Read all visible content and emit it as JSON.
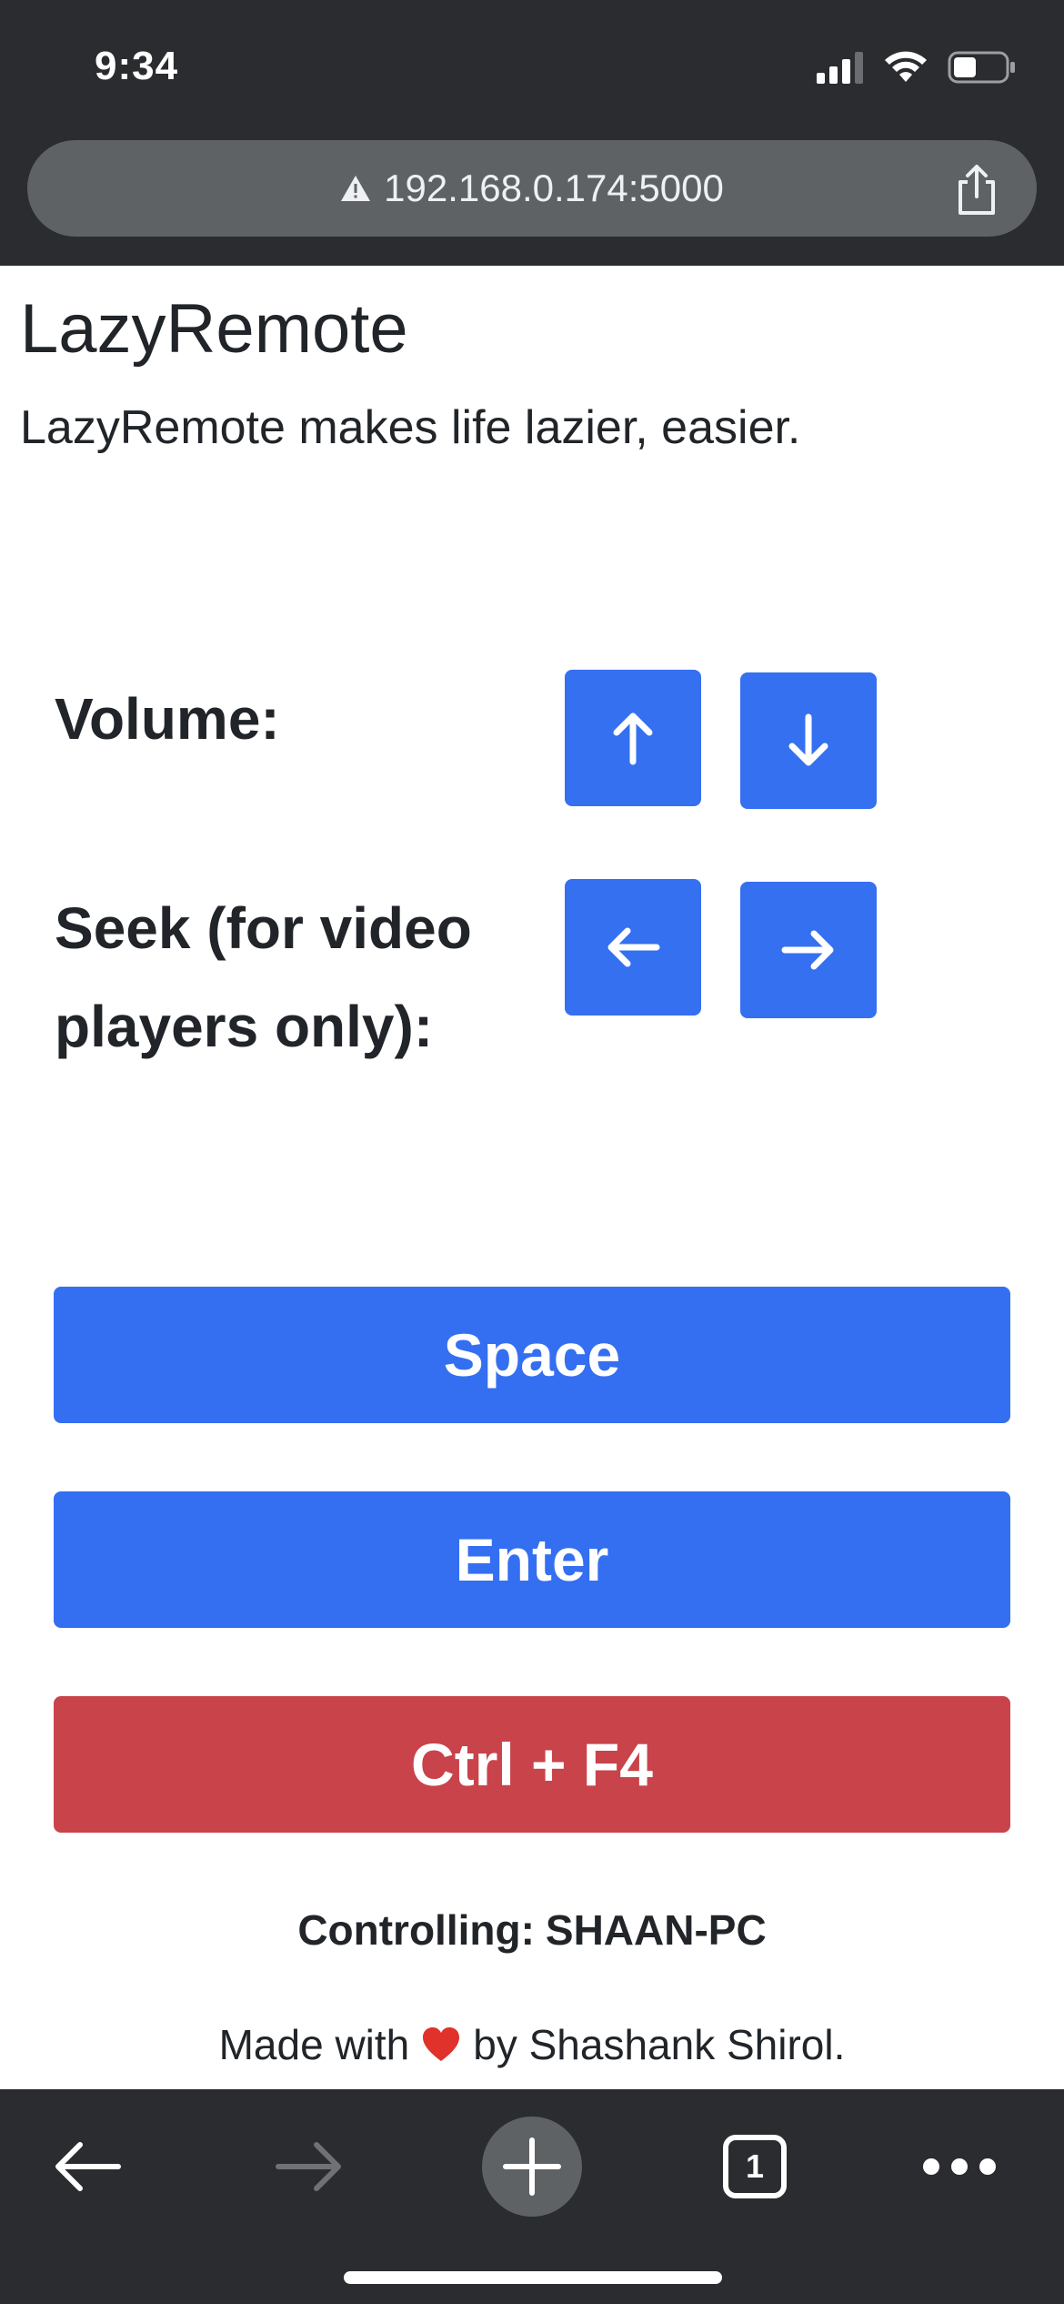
{
  "status_bar": {
    "time": "9:34",
    "icons": [
      "signal-icon",
      "wifi-icon",
      "battery-icon"
    ]
  },
  "browser": {
    "url": "192.168.0.174:5000",
    "insecure_icon": "warning-triangle-icon",
    "share_icon": "share-icon",
    "tab_count": "1",
    "toolbar_icons": [
      "back-arrow-icon",
      "forward-arrow-icon",
      "new-tab-plus-icon",
      "tabs-icon",
      "more-dots-icon"
    ]
  },
  "page": {
    "title": "LazyRemote",
    "tagline": "LazyRemote makes life lazier, easier.",
    "volume_label": "Volume:",
    "seek_label": "Seek (for video players only):",
    "space_button": "Space",
    "enter_button": "Enter",
    "close_button": "Ctrl + F4",
    "controlling_label": "Controlling:",
    "controlling_value": "SHAAN-PC",
    "footer_before": "Made with",
    "footer_after": "by Shashank Shirol."
  },
  "colors": {
    "primary": "#3470f0",
    "danger": "#c9434b",
    "chrome": "#2b2c2f",
    "url_bar": "#5f6265",
    "heart": "#e0322b"
  }
}
